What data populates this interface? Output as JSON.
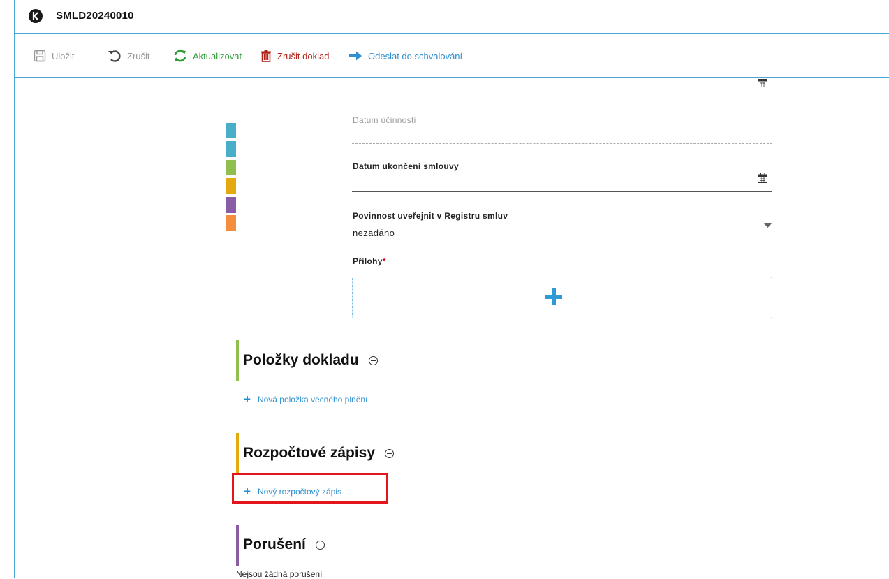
{
  "window": {
    "title": "SMLD20240010",
    "logo_icon": "k-logo-icon"
  },
  "toolbar": {
    "save_label": "Uložit",
    "cancel_label": "Zrušit",
    "refresh_label": "Aktualizovat",
    "cancel_doc_label": "Zrušit doklad",
    "send_label": "Odeslat do schvalování"
  },
  "stripe_colors": [
    "#4aaecb",
    "#4aaecb",
    "#8fbf4f",
    "#e3a90f",
    "#8a5ca6",
    "#f58d3f"
  ],
  "form": {
    "datum_ucinnosti_label": "Datum účinnosti",
    "datum_ukonceni_label": "Datum ukončení smlouvy",
    "povinnost_label": "Povinnost uveřejnit v Registru smluv",
    "povinnost_value": "nezadáno",
    "prilohy_label": "Přílohy",
    "prilohy_required": "*"
  },
  "sections": {
    "polozky": {
      "title": "Položky dokladu",
      "add_label": "Nová položka věcného plnění",
      "color": "#8fbf4f"
    },
    "rozpocet": {
      "title": "Rozpočtové zápisy",
      "add_label": "Nový rozpočtový zápis",
      "color": "#e3a90f"
    },
    "poruseni": {
      "title": "Porušení",
      "empty_text": "Nejsou žádná porušení",
      "color": "#8a5ca6"
    }
  },
  "colors": {
    "accent": "#2f8fd0",
    "frame": "#4aa8d8",
    "highlight": "#e3141a"
  }
}
